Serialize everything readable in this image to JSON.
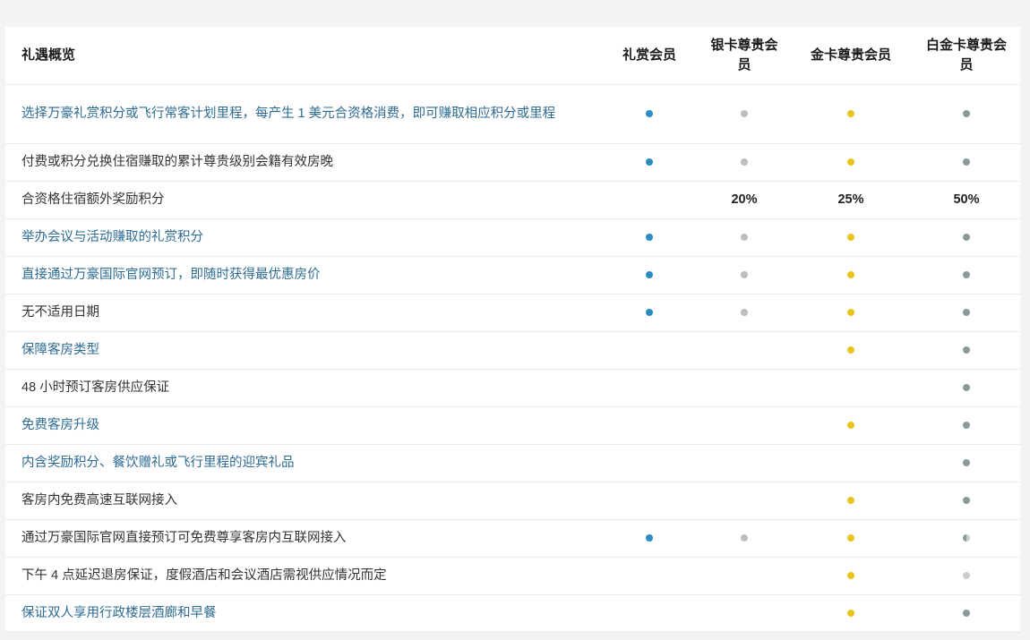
{
  "table": {
    "header": {
      "overview": "礼遇概览",
      "tiers": [
        "礼赏会员",
        "银卡尊贵会员",
        "金卡尊贵会员",
        "白金卡尊贵会员"
      ]
    },
    "colors": {
      "member": "#2b8cc4",
      "silver": "#bdbdbd",
      "gold": "#e8c51e",
      "platinum": "#8a999a",
      "platinum_light": "#c9cdcd"
    },
    "rows": [
      {
        "label": "选择万豪礼赏积分或飞行常客计划里程，每产生 1 美元合资格消费，即可赚取相应积分或里程",
        "link": true,
        "cells": [
          "dot",
          "dot",
          "dot",
          "dot"
        ]
      },
      {
        "label": "付费或积分兑换住宿赚取的累计尊贵级别会籍有效房晚",
        "link": false,
        "cells": [
          "dot",
          "dot",
          "dot",
          "dot"
        ]
      },
      {
        "label": "合资格住宿额外奖励积分",
        "link": false,
        "cells": [
          "",
          "20%",
          "25%",
          "50%"
        ]
      },
      {
        "label": "举办会议与活动赚取的礼赏积分",
        "link": true,
        "cells": [
          "dot",
          "dot",
          "dot",
          "dot"
        ]
      },
      {
        "label": "直接通过万豪国际官网预订，即随时获得最优惠房价",
        "link": true,
        "cells": [
          "dot",
          "dot",
          "dot",
          "dot"
        ]
      },
      {
        "label": "无不适用日期",
        "link": false,
        "cells": [
          "dot",
          "dot",
          "dot",
          "dot"
        ]
      },
      {
        "label": "保障客房类型",
        "link": true,
        "cells": [
          "",
          "",
          "dot",
          "dot"
        ]
      },
      {
        "label": "48 小时预订客房供应保证",
        "link": false,
        "cells": [
          "",
          "",
          "",
          "dot"
        ]
      },
      {
        "label": "免费客房升级",
        "link": true,
        "cells": [
          "",
          "",
          "dot",
          "dot"
        ]
      },
      {
        "label": "内含奖励积分、餐饮赠礼或飞行里程的迎宾礼品",
        "link": true,
        "cells": [
          "",
          "",
          "",
          "dot"
        ]
      },
      {
        "label": "客房内免费高速互联网接入",
        "link": false,
        "cells": [
          "",
          "",
          "dot",
          "dot"
        ]
      },
      {
        "label": "通过万豪国际官网直接预订可免费尊享客房内互联网接入",
        "link": false,
        "cells": [
          "dot",
          "dot",
          "dot",
          "half"
        ]
      },
      {
        "label": "下午 4 点延迟退房保证，度假酒店和会议酒店需视供应情况而定",
        "link": false,
        "cells": [
          "",
          "",
          "dot",
          "light"
        ]
      },
      {
        "label": "保证双人享用行政楼层酒廊和早餐",
        "link": true,
        "cells": [
          "",
          "",
          "dot",
          "dot"
        ]
      }
    ]
  }
}
